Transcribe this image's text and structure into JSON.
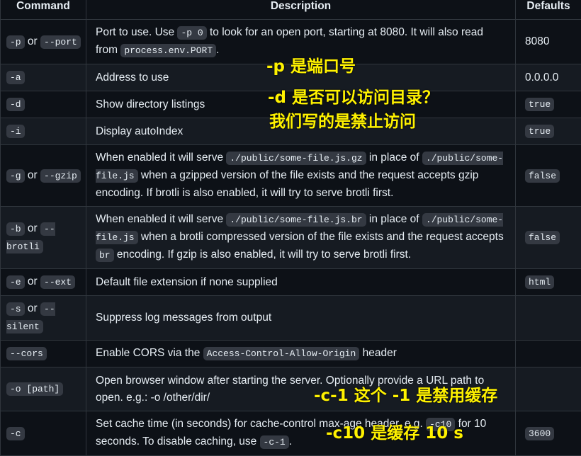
{
  "headers": {
    "command": "Command",
    "description": "Description",
    "defaults": "Defaults"
  },
  "rows": [
    {
      "cmd": {
        "c1": "-p",
        "or": " or ",
        "c2": "--port"
      },
      "desc": {
        "t1": "Port to use. Use ",
        "code1": "-p 0",
        "t2": " to look for an open port, starting at 8080. It will also read from ",
        "code2": "process.env.PORT",
        "t3": "."
      },
      "def": {
        "text": "8080"
      }
    },
    {
      "cmd": {
        "c1": "-a"
      },
      "desc": {
        "t1": "Address to use"
      },
      "def": {
        "text": "0.0.0.0"
      }
    },
    {
      "cmd": {
        "c1": "-d"
      },
      "desc": {
        "t1": "Show directory listings"
      },
      "def": {
        "code": "true"
      }
    },
    {
      "cmd": {
        "c1": "-i"
      },
      "desc": {
        "t1": "Display autoIndex"
      },
      "def": {
        "code": "true"
      }
    },
    {
      "cmd": {
        "c1": "-g",
        "or": " or ",
        "c2": "--gzip"
      },
      "desc": {
        "t1": "When enabled it will serve ",
        "code1": "./public/some-file.js.gz",
        "t2": " in place of ",
        "code2": "./public/some-file.js",
        "t3": " when a gzipped version of the file exists and the request accepts gzip encoding. If brotli is also enabled, it will try to serve brotli first."
      },
      "def": {
        "code": "false"
      }
    },
    {
      "cmd": {
        "c1": "-b",
        "or": " or ",
        "c2": "--brotli"
      },
      "desc": {
        "t1": "When enabled it will serve ",
        "code1": "./public/some-file.js.br",
        "t2": " in place of ",
        "code2": "./public/some-file.js",
        "t3": " when a brotli compressed version of the file exists and the request accepts ",
        "code3": "br",
        "t4": " encoding. If gzip is also enabled, it will try to serve brotli first."
      },
      "def": {
        "code": "false"
      }
    },
    {
      "cmd": {
        "c1": "-e",
        "or": " or ",
        "c2": "--ext"
      },
      "desc": {
        "t1": "Default file extension if none supplied"
      },
      "def": {
        "code": "html"
      }
    },
    {
      "cmd": {
        "c1": "-s",
        "or": " or ",
        "c2": "--silent"
      },
      "desc": {
        "t1": "Suppress log messages from output"
      },
      "def": {}
    },
    {
      "cmd": {
        "c1": "--cors"
      },
      "desc": {
        "t1": "Enable CORS via the ",
        "code1": "Access-Control-Allow-Origin",
        "t2": " header"
      },
      "def": {}
    },
    {
      "cmd": {
        "c1": "-o [path]"
      },
      "desc": {
        "t1": "Open browser window after starting the server. Optionally provide a URL path to open. e.g.: -o /other/dir/"
      },
      "def": {}
    },
    {
      "cmd": {
        "c1": "-c"
      },
      "desc": {
        "t1": "Set cache time (in seconds) for cache-control max-age header, e.g. ",
        "code1": "-c10",
        "t2": " for 10 seconds. To disable caching, use ",
        "code2": "-c-1",
        "t3": "."
      },
      "def": {
        "code": "3600"
      }
    }
  ],
  "annotations": {
    "a1": "-p 是端口号",
    "a2": "-d 是否可以访问目录？",
    "a3": "我们写的是禁止访问",
    "a4": "-c-1 这个 -1 是禁用缓存",
    "a5": "-c10 是缓存 10 s"
  },
  "annotation_color": "#fff200"
}
